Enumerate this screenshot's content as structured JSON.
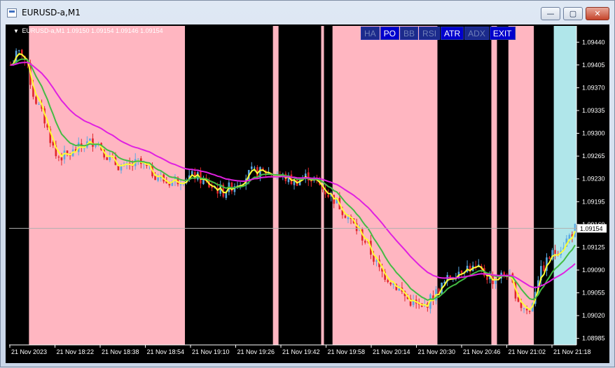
{
  "window": {
    "title": "EURUSD-a,M1",
    "minimize_glyph": "—",
    "maximize_glyph": "▢",
    "close_glyph": "✕"
  },
  "chart_header": {
    "marker": "▼",
    "symbol": "EURUSD-a,M1",
    "ohlc": "1.09150 1.09154 1.09146 1.09154"
  },
  "toolbar": [
    {
      "label": "HA",
      "active": false
    },
    {
      "label": "PO",
      "active": true
    },
    {
      "label": "BB",
      "active": false
    },
    {
      "label": "RSI",
      "active": false
    },
    {
      "label": "ATR",
      "active": true
    },
    {
      "label": "ADX",
      "active": false
    },
    {
      "label": "EXIT",
      "active": true
    }
  ],
  "colors": {
    "background": "#000000",
    "pink_zone": "#ffb6c1",
    "cyan_zone": "#b0e6ea",
    "bull_candle": "#5aa8e0",
    "bear_candle": "#e0262a",
    "ma_fast": "#ffff33",
    "ma_mid": "#44bb44",
    "ma_slow": "#e020e0",
    "axis_text": "#ffffff",
    "price_line": "#b0b0b0"
  },
  "chart_data": {
    "type": "candlestick",
    "symbol": "EURUSD-a",
    "timeframe": "M1",
    "last_price": 1.09154,
    "price_label": "1.09154",
    "ylim": [
      1.08975,
      1.09465
    ],
    "y_ticks": [
      "1.09440",
      "1.09405",
      "1.09370",
      "1.09335",
      "1.09300",
      "1.09265",
      "1.09230",
      "1.09195",
      "1.09160",
      "1.09125",
      "1.09090",
      "1.09055",
      "1.09020",
      "1.08985"
    ],
    "x_ticks": [
      "21 Nov 2023",
      "21 Nov 18:22",
      "21 Nov 18:38",
      "21 Nov 18:54",
      "21 Nov 19:10",
      "21 Nov 19:26",
      "21 Nov 19:42",
      "21 Nov 19:58",
      "21 Nov 20:14",
      "21 Nov 20:30",
      "21 Nov 20:46",
      "21 Nov 21:02",
      "21 Nov 21:18"
    ],
    "bar_count": 200,
    "zones": [
      {
        "start": 0,
        "end": 7,
        "state": "black"
      },
      {
        "start": 7,
        "end": 62,
        "state": "pink"
      },
      {
        "start": 62,
        "end": 93,
        "state": "black"
      },
      {
        "start": 93,
        "end": 95,
        "state": "pink"
      },
      {
        "start": 95,
        "end": 110,
        "state": "black"
      },
      {
        "start": 110,
        "end": 111,
        "state": "pink"
      },
      {
        "start": 111,
        "end": 114,
        "state": "black"
      },
      {
        "start": 114,
        "end": 151,
        "state": "pink"
      },
      {
        "start": 151,
        "end": 170,
        "state": "black"
      },
      {
        "start": 170,
        "end": 172,
        "state": "pink"
      },
      {
        "start": 172,
        "end": 176,
        "state": "black"
      },
      {
        "start": 176,
        "end": 185,
        "state": "pink"
      },
      {
        "start": 185,
        "end": 192,
        "state": "black"
      },
      {
        "start": 192,
        "end": 200,
        "state": "cyan"
      }
    ],
    "path_knots": [
      [
        0,
        1.09405
      ],
      [
        2,
        1.0942
      ],
      [
        4,
        1.09425
      ],
      [
        6,
        1.094
      ],
      [
        8,
        1.0936
      ],
      [
        12,
        1.0932
      ],
      [
        16,
        1.09265
      ],
      [
        20,
        1.09265
      ],
      [
        25,
        1.0928
      ],
      [
        30,
        1.0929
      ],
      [
        35,
        1.0926
      ],
      [
        40,
        1.09245
      ],
      [
        45,
        1.09255
      ],
      [
        50,
        1.0924
      ],
      [
        55,
        1.09225
      ],
      [
        60,
        1.0923
      ],
      [
        65,
        1.09235
      ],
      [
        70,
        1.0922
      ],
      [
        75,
        1.0921
      ],
      [
        80,
        1.09225
      ],
      [
        85,
        1.0924
      ],
      [
        90,
        1.0924
      ],
      [
        95,
        1.09235
      ],
      [
        100,
        1.09225
      ],
      [
        105,
        1.09235
      ],
      [
        110,
        1.09215
      ],
      [
        115,
        1.09195
      ],
      [
        120,
        1.09165
      ],
      [
        125,
        1.09135
      ],
      [
        130,
        1.0909
      ],
      [
        135,
        1.0907
      ],
      [
        140,
        1.09045
      ],
      [
        145,
        1.0903
      ],
      [
        150,
        1.09055
      ],
      [
        155,
        1.0908
      ],
      [
        160,
        1.09095
      ],
      [
        165,
        1.0909
      ],
      [
        170,
        1.09075
      ],
      [
        175,
        1.09085
      ],
      [
        180,
        1.09035
      ],
      [
        183,
        1.09025
      ],
      [
        186,
        1.0908
      ],
      [
        190,
        1.0911
      ],
      [
        195,
        1.0913
      ],
      [
        199,
        1.09154
      ]
    ],
    "series": [
      {
        "indicator": "fast moving average",
        "color": "#ffff33",
        "period": 3
      },
      {
        "indicator": "mid moving average",
        "color": "#44bb44",
        "period": 10
      },
      {
        "indicator": "slow moving average",
        "color": "#e020e0",
        "period": 30
      }
    ]
  }
}
